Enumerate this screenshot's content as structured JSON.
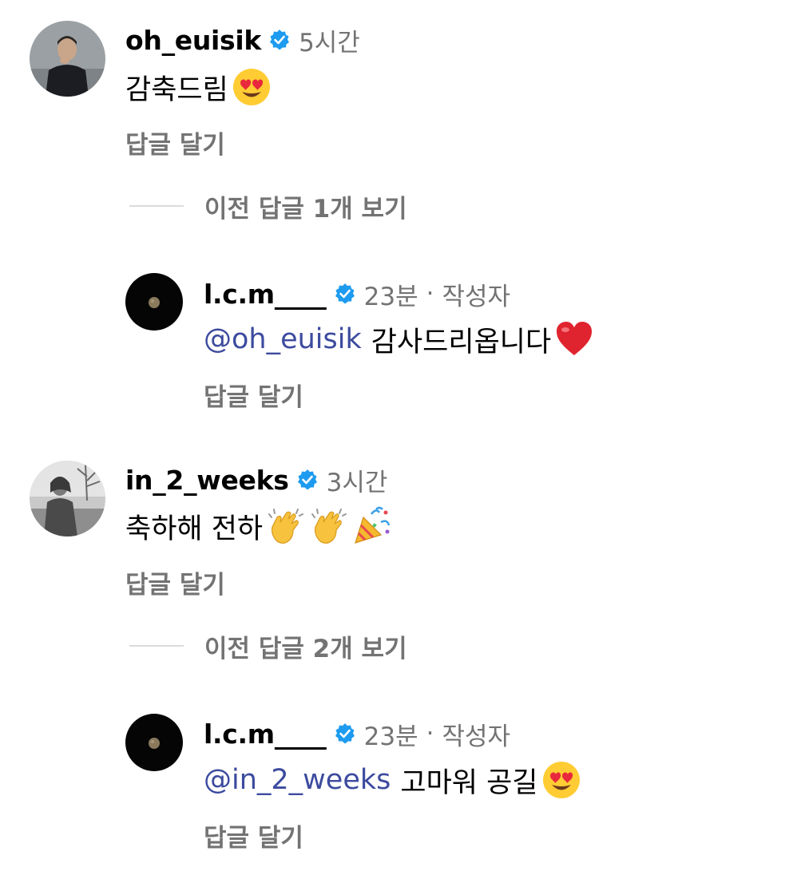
{
  "colors": {
    "username": "#000000",
    "meta": "#737373",
    "mention": "#3c4b9e",
    "verified": "#1d9bf0",
    "divider": "#dbdbdb"
  },
  "comments": [
    {
      "username": "oh_euisik",
      "time": "5시간",
      "text": "감축드림",
      "emojis": [
        "heart-eyes-emoji"
      ],
      "reply_label": "답글 달기",
      "view_replies_label": "이전 답글 1개 보기",
      "reply": {
        "username": "l.c.m____",
        "time": "23분",
        "author_label": "작성자",
        "mention": "@oh_euisik",
        "text": "감사드리옵니다",
        "emojis": [
          "red-heart-emoji"
        ],
        "reply_label": "답글 달기"
      }
    },
    {
      "username": "in_2_weeks",
      "time": "3시간",
      "text": "축하해 전하",
      "emojis": [
        "clapping-hands-emoji",
        "clapping-hands-emoji",
        "party-popper-emoji"
      ],
      "reply_label": "답글 달기",
      "view_replies_label": "이전 답글 2개 보기",
      "reply": {
        "username": "l.c.m____",
        "time": "23분",
        "author_label": "작성자",
        "mention": "@in_2_weeks",
        "text": "고마워 공길",
        "emojis": [
          "heart-eyes-emoji"
        ],
        "reply_label": "답글 달기"
      }
    }
  ]
}
